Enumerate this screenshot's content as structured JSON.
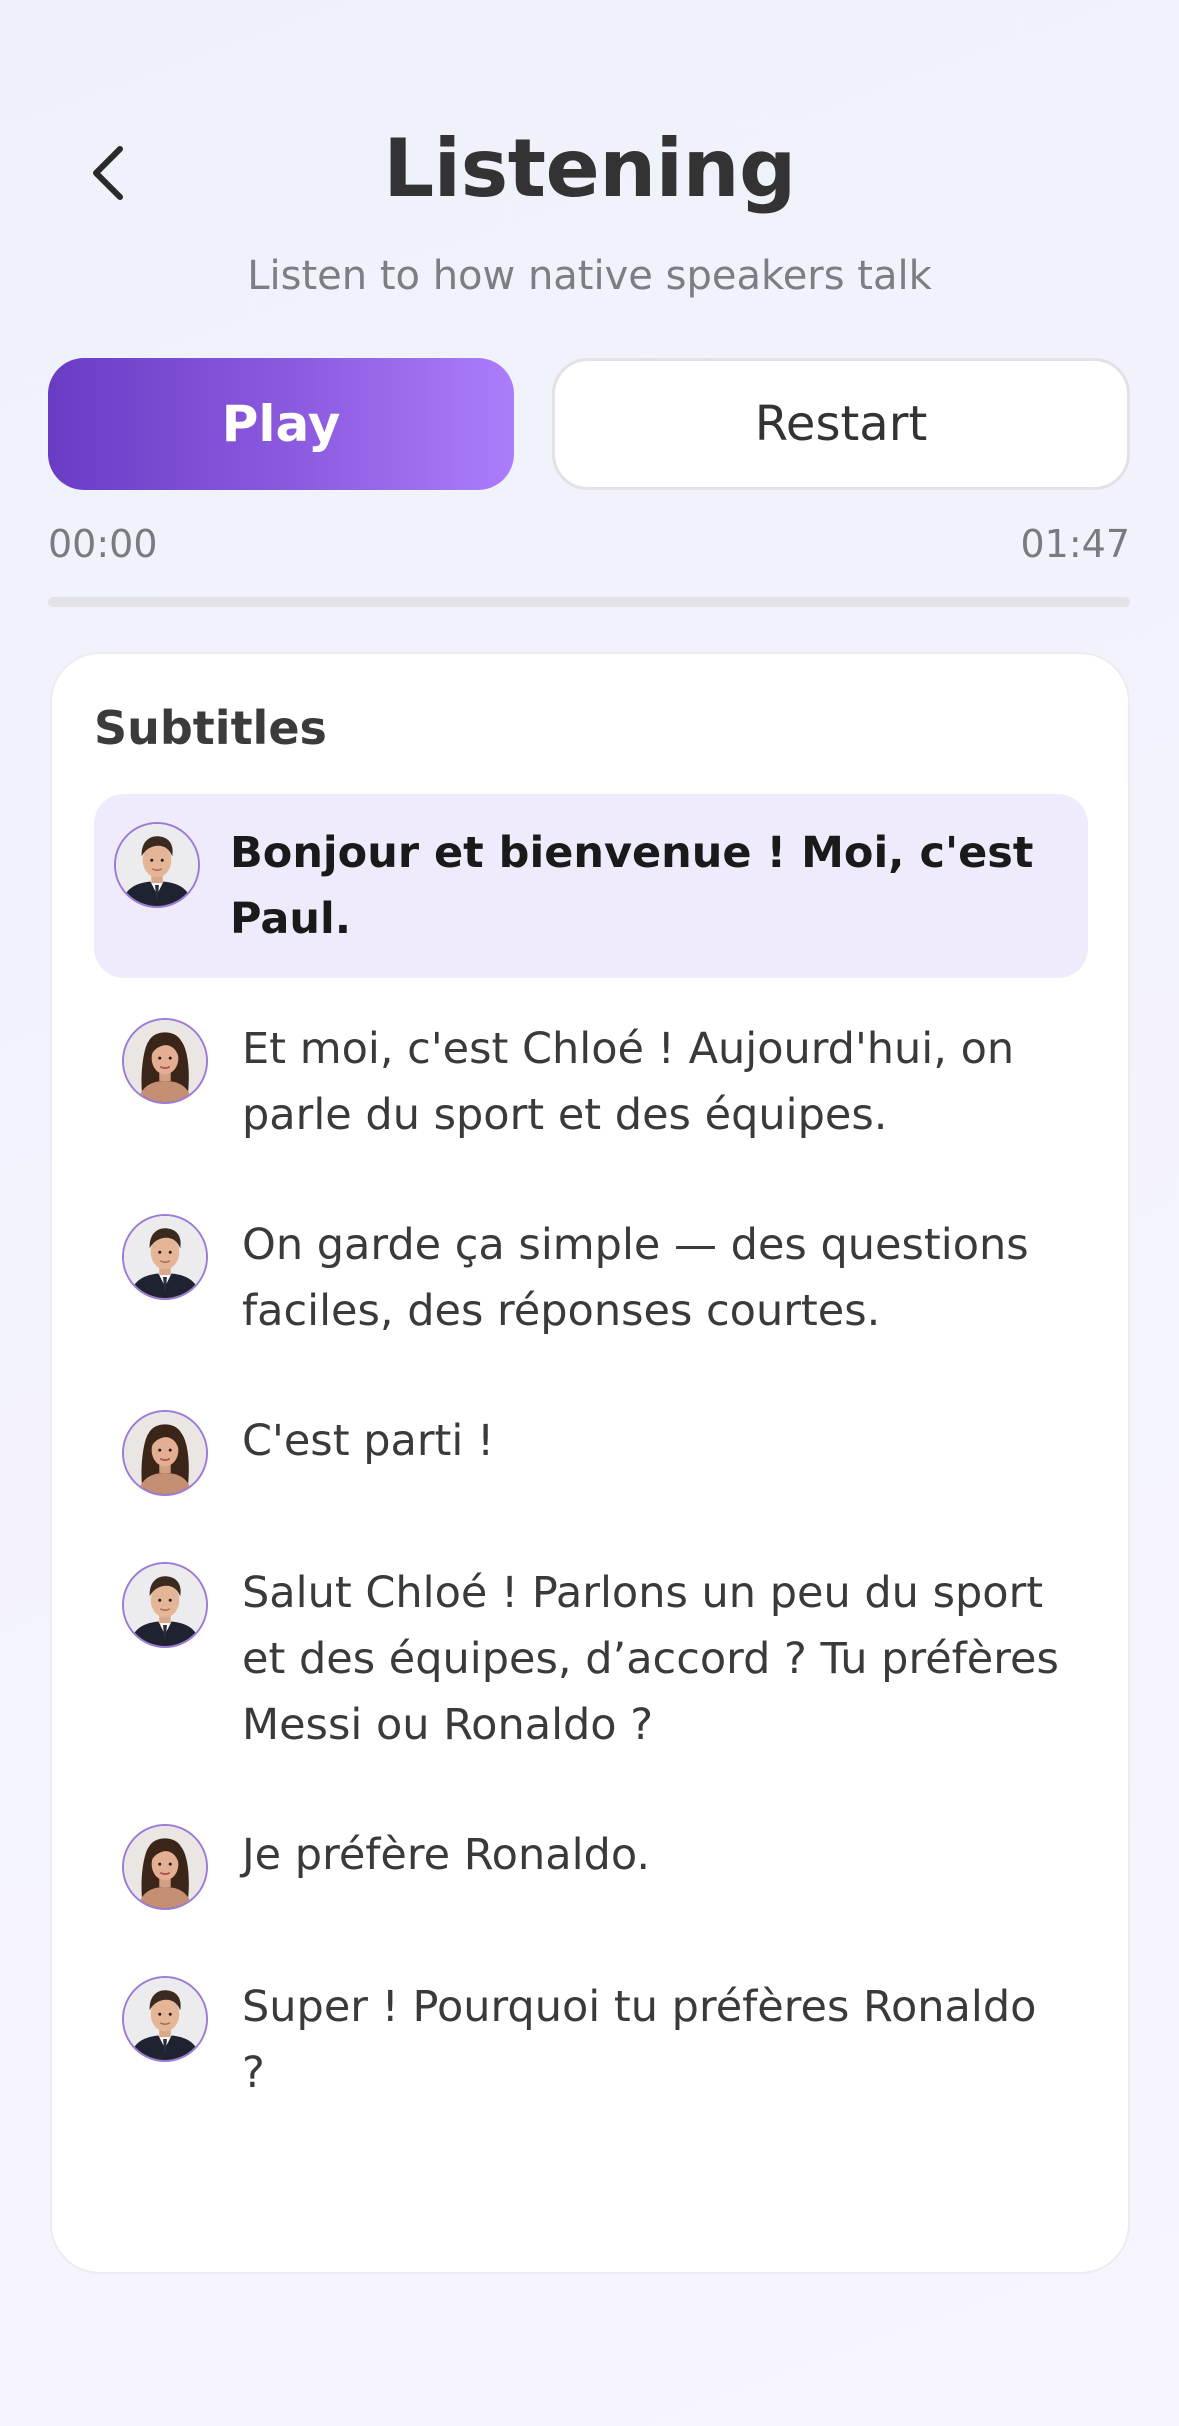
{
  "header": {
    "title": "Listening",
    "subtitle": "Listen to how native speakers talk"
  },
  "controls": {
    "play_label": "Play",
    "restart_label": "Restart",
    "accent_gradient": [
      "#6a3cc4",
      "#ab7dfb"
    ]
  },
  "timeline": {
    "current_time": "00:00",
    "total_time": "01:47",
    "progress": 0
  },
  "subtitles": {
    "heading": "Subtitles",
    "items": [
      {
        "speaker": "male",
        "text": "Bonjour et bienvenue ! Moi, c'est Paul.",
        "active": true
      },
      {
        "speaker": "female",
        "text": "Et moi, c'est Chloé ! Aujourd'hui, on parle du sport et des équipes.",
        "active": false
      },
      {
        "speaker": "male",
        "text": "On garde ça simple — des questions faciles, des réponses courtes.",
        "active": false
      },
      {
        "speaker": "female",
        "text": "C'est parti !",
        "active": false
      },
      {
        "speaker": "male",
        "text": "Salut Chloé ! Parlons un peu du sport et des équipes, d’accord ? Tu préfères Messi ou Ronaldo ?",
        "active": false
      },
      {
        "speaker": "female",
        "text": "Je préfère Ronaldo.",
        "active": false
      },
      {
        "speaker": "male",
        "text": "Super ! Pourquoi tu préfères Ronaldo ?",
        "active": false
      }
    ]
  }
}
